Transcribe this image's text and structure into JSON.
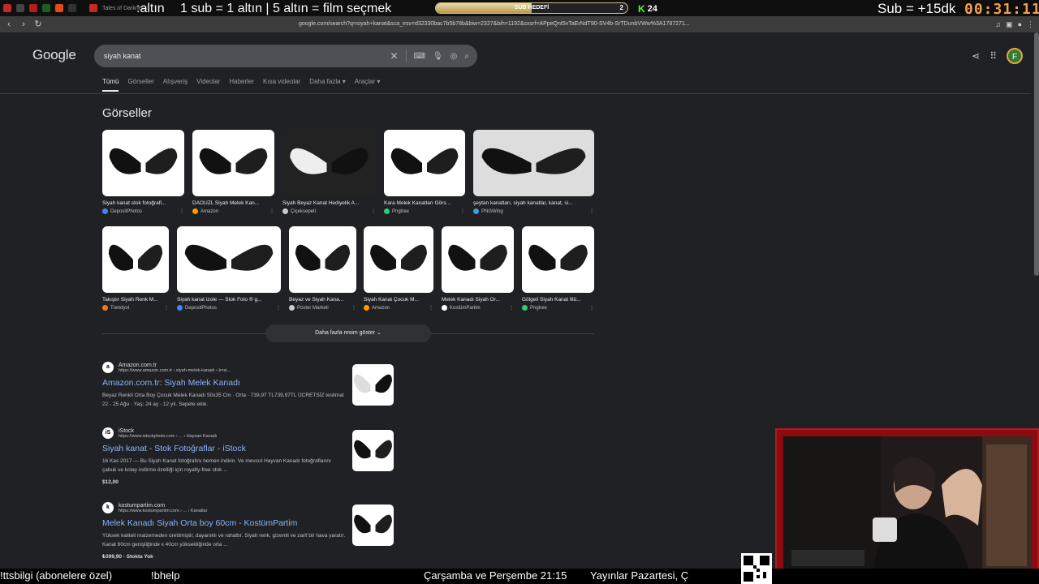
{
  "overlay": {
    "left_text": ":altın",
    "rule_text": "1 sub = 1 altın | 5 altın = film seçmek",
    "goal": {
      "label": "SUB HEDEFİ",
      "min": "",
      "max": "2",
      "progress": 0.5
    },
    "kick_viewers": "24",
    "sub_text": "Sub = +15dk",
    "timer": "00:31:11"
  },
  "browser": {
    "tab_title": "Tales of Darkness",
    "url": "google.com/search?q=siyah+kanat&sca_esv=d32330bac7b5b78b&biw=2327&bih=1192&sxsrf=APpeQnt5vTaErNdT90-SV4b-SrTDunbVWw%3A1787271..."
  },
  "google": {
    "logo": "Google",
    "query": "siyah kanat",
    "avatar_letter": "F",
    "tabs": [
      "Tümü",
      "Görseller",
      "Alışveriş",
      "Videolar",
      "Haberler",
      "Kısa videolar",
      "Daha fazla ▾",
      "Araçlar ▾"
    ],
    "images_title": "Görseller",
    "images_row1": [
      {
        "caption": "Siyah kanat stok fotoğrafl...",
        "source": "DepositPhotos",
        "color": "#4285f4"
      },
      {
        "caption": "DAOUZL Siyah Melek Kan...",
        "source": "Amazon",
        "color": "#ff9900"
      },
      {
        "caption": "Siyah Beyaz Kanat Hediyelik A...",
        "source": "Çiçeksepeti",
        "color": "#ccc"
      },
      {
        "caption": "Kara Melek Kanatları Görs...",
        "source": "Pngtree",
        "color": "#2ecc71"
      },
      {
        "caption": "şeytan kanatları, siyah kanatlar, kanat, si...",
        "source": "PNGWing",
        "color": "#3ea0d8"
      }
    ],
    "images_row2": [
      {
        "caption": "Takıştır Siyah Renk M...",
        "source": "Trendyol",
        "color": "#f27a1a"
      },
      {
        "caption": "Siyah kanat izole — Stok Foto ® g...",
        "source": "DepositPhotos",
        "color": "#4285f4"
      },
      {
        "caption": "Beyaz ve Siyah Kana...",
        "source": "Poster Marketi",
        "color": "#ccc"
      },
      {
        "caption": "Siyah Kanat Çocuk M...",
        "source": "Amazon",
        "color": "#ff9900"
      },
      {
        "caption": "Melek Kanadı Siyah Or...",
        "source": "KostümPartim",
        "color": "#fff"
      },
      {
        "caption": "Gölgeli Siyah Kanat İllü...",
        "source": "Pngtree",
        "color": "#2ecc71"
      }
    ],
    "more_images": "Daha fazla resim göster ⌄",
    "results": [
      {
        "site": "Amazon.com.tr",
        "url": "https://www.amazon.com.tr › siyah-melek-kanadı › k=si...",
        "title": "Amazon.com.tr: Siyah Melek Kanadı",
        "snippet": "Beyaz Renkli Orta Boy Çocuk Melek Kanadı 50x35 Cm · Orta · 739,97 TL739,97TL ÜCRETSİZ teslimat 22 - 25 Ağu · Yaş: 24 ay - 12 yıl. Sepete ekle.",
        "extra": "",
        "fav": "a"
      },
      {
        "site": "iStock",
        "url": "https://www.istockphoto.com › ... › Hayvan Kanadı",
        "title": "Siyah kanat - Stok Fotoğraflar - iStock",
        "snippet": "16 Kas 2017 — Bu Siyah Kanat fotoğrafını hemen indirin. Ve mevcut Hayvan Kanadı fotoğraflarını çabuk ve kolay indirme özelliği için royalty-free stok ...",
        "extra": "$12,00",
        "fav": "iS"
      },
      {
        "site": "kostumpartim.com",
        "url": "https://www.kostumpartim.com › ... › Kanatlar",
        "title": "Melek Kanadı Siyah Orta boy 60cm - KostümPartim",
        "snippet": "Yüksek kaliteli malzemeden üretilmiştir, dayanıklı ve rahattır. Siyah renk, gizemli ve zarif bir hava yaratır. Kanat 60cm genişliğinde x 40cm yüksekliğinde orta ...",
        "extra": "₺399,90 · Stokta Yok",
        "fav": "k"
      }
    ]
  },
  "ticker": {
    "left": "!ttsbilgi (abonelere özel)",
    "cmd": "!bhelp",
    "schedule": "Çarşamba ve Perşembe 21:15",
    "schedule2": "Yayınlar Pazartesi, Ç"
  }
}
